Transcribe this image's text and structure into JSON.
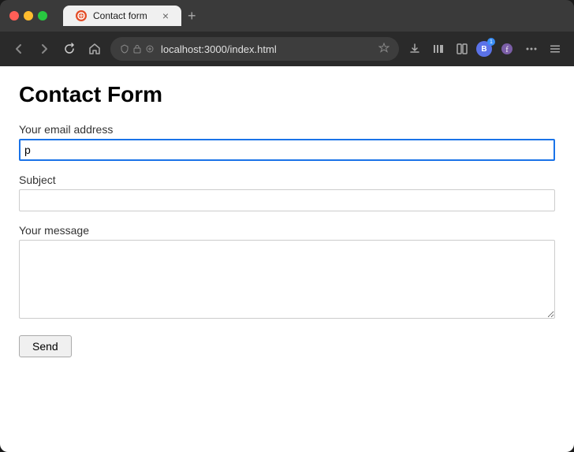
{
  "browser": {
    "tab_favicon": "●",
    "tab_title": "Contact form",
    "tab_close": "×",
    "new_tab": "+",
    "nav_back": "←",
    "nav_forward": "→",
    "nav_refresh": "↻",
    "nav_home": "⌂",
    "url": "localhost:3000/index.html",
    "star_icon": "☆",
    "download_icon": "↓",
    "menu_icon": "≡"
  },
  "page": {
    "title": "Contact Form",
    "form": {
      "email_label": "Your email address",
      "email_value": "p",
      "email_placeholder": "",
      "subject_label": "Subject",
      "subject_value": "",
      "subject_placeholder": "",
      "message_label": "Your message",
      "message_value": "",
      "message_placeholder": "",
      "submit_label": "Send"
    }
  }
}
